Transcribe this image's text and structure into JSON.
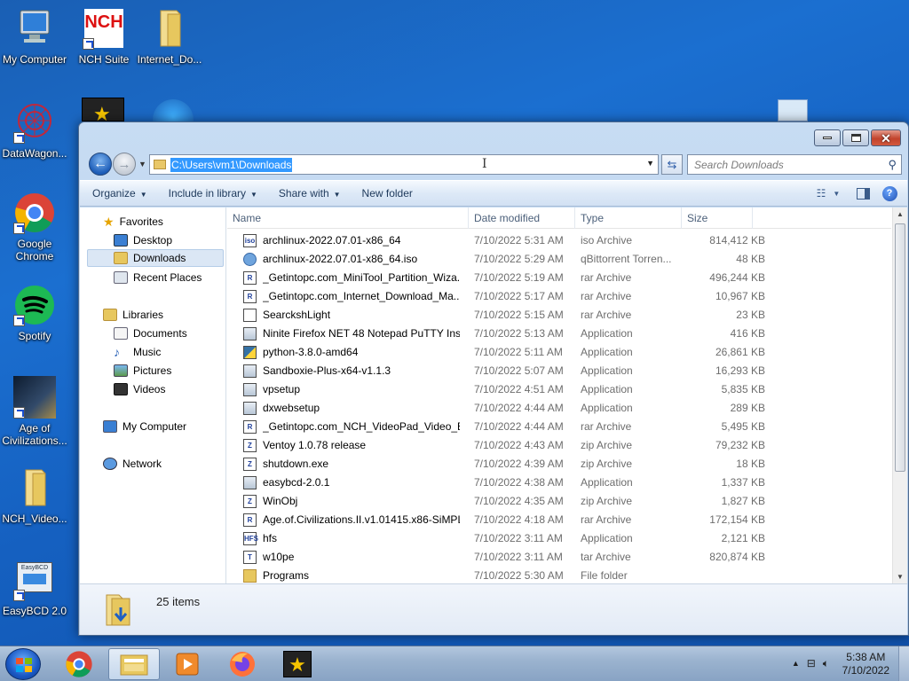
{
  "desktop": {
    "icons": [
      {
        "label": "My Computer"
      },
      {
        "label": "NCH Suite"
      },
      {
        "label": "Internet_Do..."
      },
      {
        "label": "DataWagon..."
      },
      {
        "label": "Google Chrome"
      },
      {
        "label": "Spotify"
      },
      {
        "label": "Age of Civilizations..."
      },
      {
        "label": "NCH_Video..."
      },
      {
        "label": "EasyBCD 2.0"
      }
    ],
    "ncH_logo_text": "NCH",
    "easybcd_logo_text": "EasyBCD"
  },
  "window": {
    "address_path": "C:\\Users\\vm1\\Downloads",
    "search_placeholder": "Search Downloads",
    "toolbar": {
      "organize": "Organize",
      "include_in_library": "Include in library",
      "share_with": "Share with",
      "new_folder": "New folder"
    },
    "nav": {
      "favorites": "Favorites",
      "desktop": "Desktop",
      "downloads": "Downloads",
      "recent_places": "Recent Places",
      "libraries": "Libraries",
      "documents": "Documents",
      "music": "Music",
      "pictures": "Pictures",
      "videos": "Videos",
      "my_computer": "My Computer",
      "network": "Network"
    },
    "columns": {
      "name": "Name",
      "date_modified": "Date modified",
      "type": "Type",
      "size": "Size"
    },
    "files": [
      {
        "name": "archlinux-2022.07.01-x86_64",
        "date": "7/10/2022 5:31 AM",
        "type": "iso Archive",
        "size": "814,412 KB",
        "icon": "iso-icon",
        "badge": "iso"
      },
      {
        "name": "archlinux-2022.07.01-x86_64.iso",
        "date": "7/10/2022 5:29 AM",
        "type": "qBittorrent Torren...",
        "size": "48 KB",
        "icon": "torrent-icon",
        "badge": ""
      },
      {
        "name": "_Getintopc.com_MiniTool_Partition_Wiza...",
        "date": "7/10/2022 5:19 AM",
        "type": "rar Archive",
        "size": "496,244 KB",
        "icon": "rar-icon",
        "badge": "R"
      },
      {
        "name": "_Getintopc.com_Internet_Download_Ma...",
        "date": "7/10/2022 5:17 AM",
        "type": "rar Archive",
        "size": "10,967 KB",
        "icon": "rar-icon",
        "badge": "R"
      },
      {
        "name": "SearckshLight",
        "date": "7/10/2022 5:15 AM",
        "type": "rar Archive",
        "size": "23 KB",
        "icon": "file-icon",
        "badge": ""
      },
      {
        "name": "Ninite Firefox NET 48 Notepad PuTTY Ins...",
        "date": "7/10/2022 5:13 AM",
        "type": "Application",
        "size": "416 KB",
        "icon": "app-icon",
        "badge": ""
      },
      {
        "name": "python-3.8.0-amd64",
        "date": "7/10/2022 5:11 AM",
        "type": "Application",
        "size": "26,861 KB",
        "icon": "python-icon",
        "badge": ""
      },
      {
        "name": "Sandboxie-Plus-x64-v1.1.3",
        "date": "7/10/2022 5:07 AM",
        "type": "Application",
        "size": "16,293 KB",
        "icon": "sandboxie-icon",
        "badge": ""
      },
      {
        "name": "vpsetup",
        "date": "7/10/2022 4:51 AM",
        "type": "Application",
        "size": "5,835 KB",
        "icon": "setup-icon",
        "badge": ""
      },
      {
        "name": "dxwebsetup",
        "date": "7/10/2022 4:44 AM",
        "type": "Application",
        "size": "289 KB",
        "icon": "dx-icon",
        "badge": ""
      },
      {
        "name": "_Getintopc.com_NCH_VideoPad_Video_E...",
        "date": "7/10/2022 4:44 AM",
        "type": "rar Archive",
        "size": "5,495 KB",
        "icon": "rar-icon",
        "badge": "R"
      },
      {
        "name": "Ventoy 1.0.78 release",
        "date": "7/10/2022 4:43 AM",
        "type": "zip Archive",
        "size": "79,232 KB",
        "icon": "zip-icon",
        "badge": "Z"
      },
      {
        "name": "shutdown.exe",
        "date": "7/10/2022 4:39 AM",
        "type": "zip Archive",
        "size": "18 KB",
        "icon": "zip-icon",
        "badge": "Z"
      },
      {
        "name": "easybcd-2.0.1",
        "date": "7/10/2022 4:38 AM",
        "type": "Application",
        "size": "1,337 KB",
        "icon": "easybcd-icon",
        "badge": ""
      },
      {
        "name": "WinObj",
        "date": "7/10/2022 4:35 AM",
        "type": "zip Archive",
        "size": "1,827 KB",
        "icon": "zip-icon",
        "badge": "Z"
      },
      {
        "name": "Age.of.Civilizations.II.v1.01415.x86-SiMPL...",
        "date": "7/10/2022 4:18 AM",
        "type": "rar Archive",
        "size": "172,154 KB",
        "icon": "rar-icon",
        "badge": "R"
      },
      {
        "name": "hfs",
        "date": "7/10/2022 3:11 AM",
        "type": "Application",
        "size": "2,121 KB",
        "icon": "hfs-icon",
        "badge": "HFS"
      },
      {
        "name": "w10pe",
        "date": "7/10/2022 3:11 AM",
        "type": "tar Archive",
        "size": "820,874 KB",
        "icon": "tar-icon",
        "badge": "T"
      },
      {
        "name": "Programs",
        "date": "7/10/2022 5:30 AM",
        "type": "File folder",
        "size": "",
        "icon": "folder-icon",
        "badge": ""
      }
    ],
    "item_count": "25 items"
  },
  "taskbar": {
    "time": "5:38 AM",
    "date": "7/10/2022"
  }
}
